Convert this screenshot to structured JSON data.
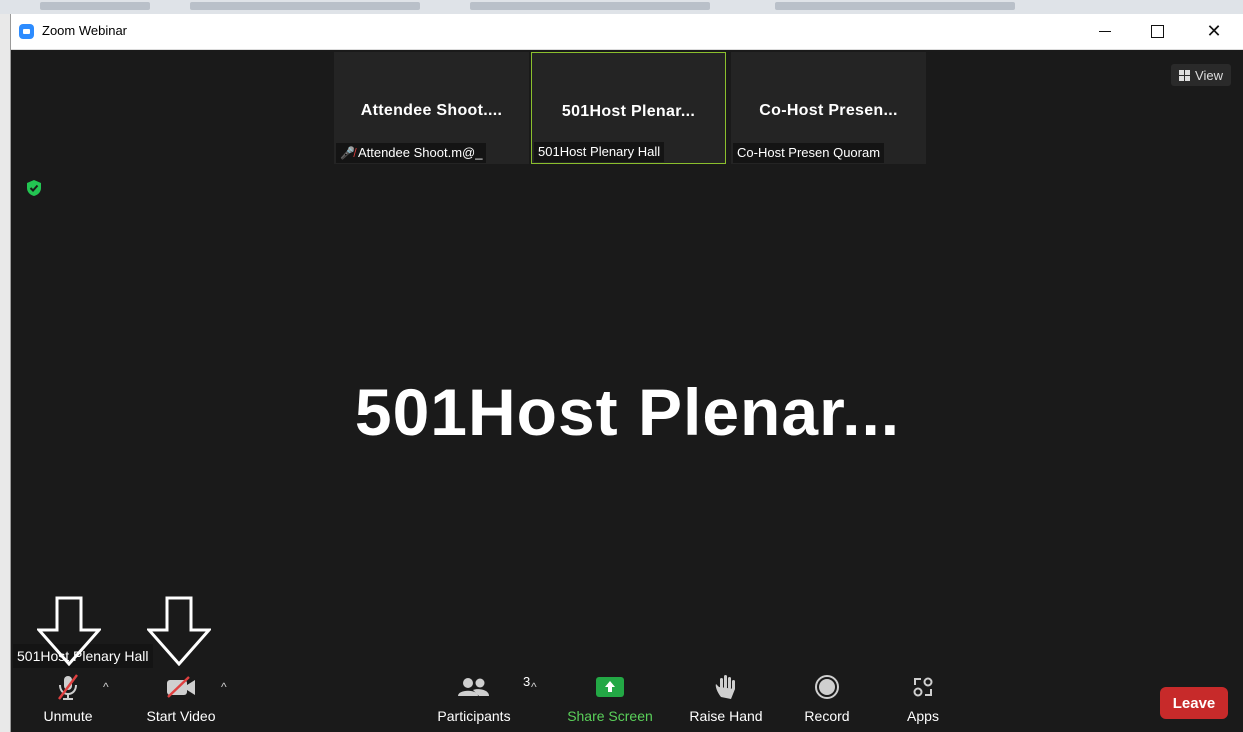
{
  "window": {
    "title": "Zoom Webinar",
    "controls": {
      "minimize": "minimize",
      "maximize": "maximize",
      "close": "✕"
    }
  },
  "thumbnails": [
    {
      "name": "Attendee  Shoot....",
      "label": "Attendee Shoot.m@_",
      "muted": true,
      "active": false
    },
    {
      "name": "501Host  Plenar...",
      "label": "501Host Plenary Hall",
      "muted": false,
      "active": true
    },
    {
      "name": "Co-Host  Presen...",
      "label": "Co-Host Presen Quoram",
      "muted": false,
      "active": false
    }
  ],
  "view_button": {
    "label": "View"
  },
  "main": {
    "speaker_name": "501Host  Plenar...",
    "active_label": "501Host Plenary Hall"
  },
  "toolbar": {
    "unmute_label": "Unmute",
    "start_video_label": "Start Video",
    "participants_label": "Participants",
    "participants_count": "3",
    "share_screen_label": "Share Screen",
    "raise_hand_label": "Raise Hand",
    "record_label": "Record",
    "apps_label": "Apps",
    "leave_label": "Leave"
  },
  "colors": {
    "background": "#1a1a1a",
    "active_thumb_border": "#8bbf2d",
    "share_green": "#23a845",
    "leave_red": "#c72a2a",
    "muted_red": "#e04040",
    "zoom_blue": "#2d8cff"
  },
  "icons": {
    "mic": "microphone-muted-icon",
    "video": "camera-off-icon",
    "participants": "people-icon",
    "share": "share-up-arrow-icon",
    "hand": "hand-icon",
    "record": "record-dot-icon",
    "apps": "apps-icon",
    "shield": "encryption-shield-icon",
    "view": "grid-view-icon"
  }
}
